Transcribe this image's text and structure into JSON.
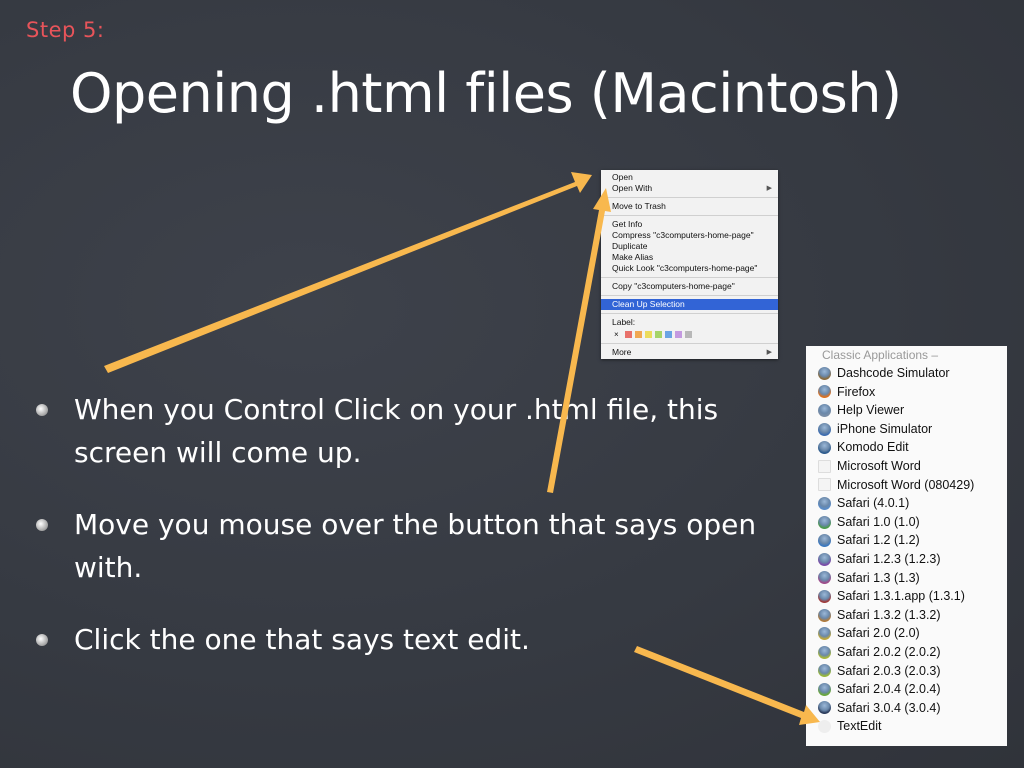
{
  "slide": {
    "step_label": "Step 5:",
    "title": "Opening .html files (Macintosh)",
    "bullets": [
      "When you Control Click on your .html file, this screen will come up.",
      "Move you mouse over the button that says open with.",
      "Click the one that says text edit."
    ]
  },
  "context_menu": {
    "groups": [
      [
        {
          "label": "Open"
        },
        {
          "label": "Open With",
          "submenu": true
        }
      ],
      [
        {
          "label": "Move to Trash"
        }
      ],
      [
        {
          "label": "Get Info"
        },
        {
          "label": "Compress \"c3computers-home-page\""
        },
        {
          "label": "Duplicate"
        },
        {
          "label": "Make Alias"
        },
        {
          "label": "Quick Look \"c3computers-home-page\""
        }
      ],
      [
        {
          "label": "Copy \"c3computers-home-page\""
        }
      ],
      [
        {
          "label": "Clean Up Selection",
          "highlighted": true
        }
      ]
    ],
    "label_heading": "Label:",
    "label_clear": "×",
    "label_colors": [
      "#e8716b",
      "#f0a852",
      "#ecdc5c",
      "#a6d46a",
      "#6ba4e4",
      "#c49ae0",
      "#b8b8b8"
    ],
    "more_label": "More",
    "submenu_arrow": "▶"
  },
  "open_with_menu": {
    "header": "Classic Applications –",
    "items": [
      {
        "label": "Dashcode Simulator",
        "icon": "dashcode-icon",
        "color": "#8a6a3a"
      },
      {
        "label": "Firefox",
        "icon": "firefox-icon",
        "color": "#e0701c"
      },
      {
        "label": "Help Viewer",
        "icon": "help-viewer-icon",
        "color": "#7a8ea8"
      },
      {
        "label": "iPhone Simulator",
        "icon": "iphone-simulator-icon",
        "color": "#3c6cb0"
      },
      {
        "label": "Komodo Edit",
        "icon": "komodo-icon",
        "color": "#2c5a8c"
      },
      {
        "label": "Microsoft Word",
        "icon": "blank-app-icon",
        "color": ""
      },
      {
        "label": "Microsoft Word (080429)",
        "icon": "blank-app-icon",
        "color": ""
      },
      {
        "label": "Safari (4.0.1)",
        "icon": "safari-icon",
        "color": "#5a8cc8"
      },
      {
        "label": "Safari 1.0 (1.0)",
        "icon": "safari-icon",
        "color": "#4a9a4a"
      },
      {
        "label": "Safari 1.2 (1.2)",
        "icon": "safari-icon",
        "color": "#3a78c0"
      },
      {
        "label": "Safari 1.2.3 (1.2.3)",
        "icon": "safari-icon",
        "color": "#7a4aa8"
      },
      {
        "label": "Safari 1.3 (1.3)",
        "icon": "safari-icon",
        "color": "#a04a8a"
      },
      {
        "label": "Safari 1.3.1.app (1.3.1)",
        "icon": "safari-icon",
        "color": "#a03a3a"
      },
      {
        "label": "Safari 1.3.2 (1.3.2)",
        "icon": "safari-icon",
        "color": "#b07a3a"
      },
      {
        "label": "Safari 2.0 (2.0)",
        "icon": "safari-icon",
        "color": "#c0a83a"
      },
      {
        "label": "Safari 2.0.2 (2.0.2)",
        "icon": "safari-icon",
        "color": "#a8b83a"
      },
      {
        "label": "Safari 2.0.3 (2.0.3)",
        "icon": "safari-icon",
        "color": "#98b83a"
      },
      {
        "label": "Safari 2.0.4 (2.0.4)",
        "icon": "safari-icon",
        "color": "#6aa83a"
      },
      {
        "label": "Safari 3.0.4 (3.0.4)",
        "icon": "safari-icon",
        "color": "#2a3a5a"
      },
      {
        "label": "TextEdit",
        "icon": "textedit-icon",
        "color": "#d8d8d8"
      }
    ]
  },
  "colors": {
    "background": "#363a42",
    "step_label": "#e8545a",
    "arrow": "#f8b84e",
    "highlight": "#3264d6"
  }
}
